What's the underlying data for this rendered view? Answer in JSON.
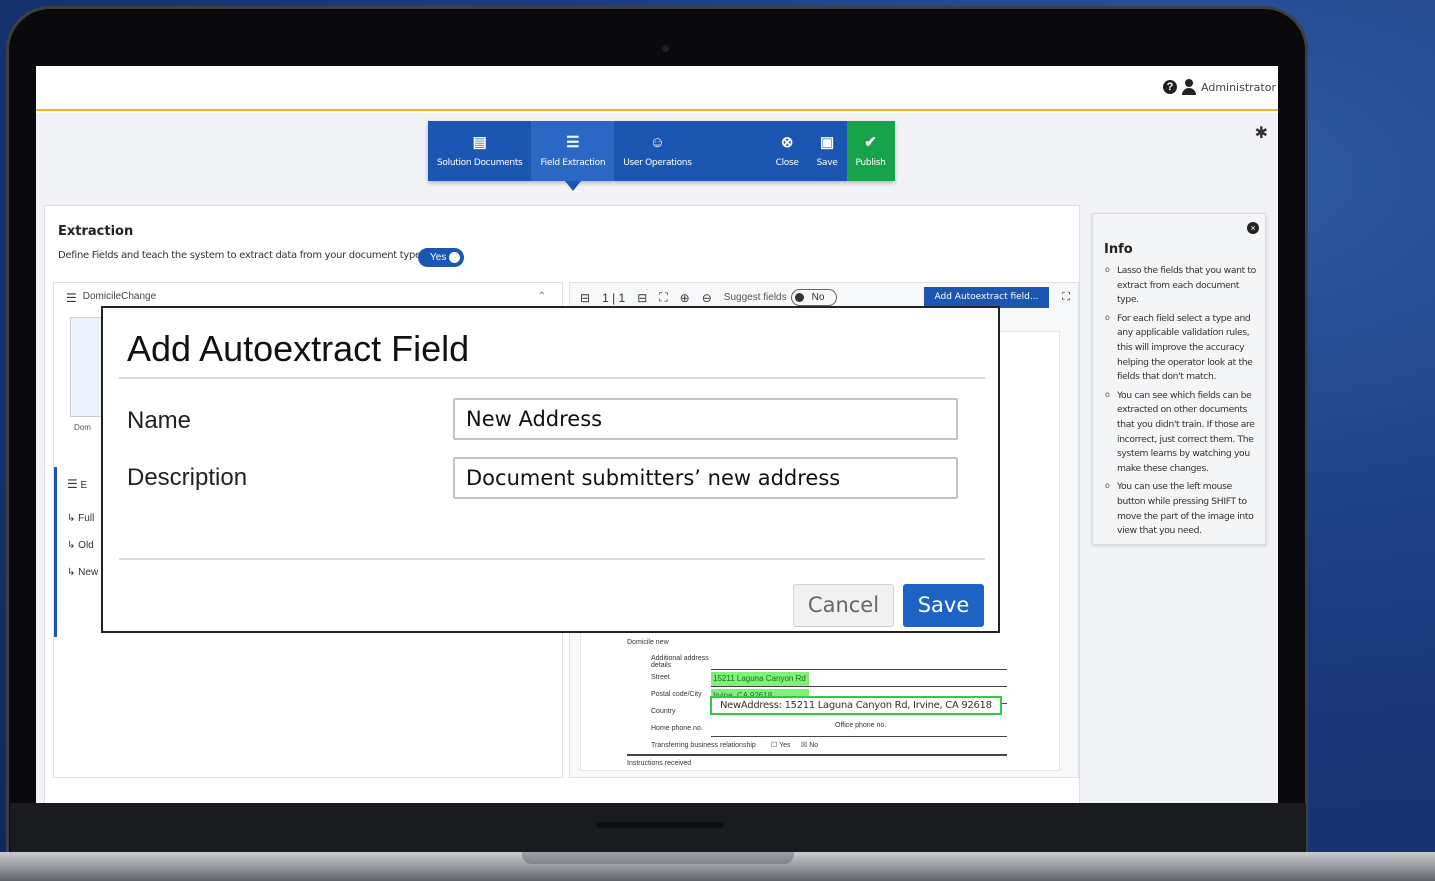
{
  "header": {
    "user_label": "Administrator"
  },
  "toolbar": {
    "solution_documents": "Solution Documents",
    "field_extraction": "Field Extraction",
    "user_operations": "User Operations",
    "close": "Close",
    "save": "Save",
    "publish": "Publish",
    "accent": "#1c56b3",
    "publish_color": "#16a34a"
  },
  "extraction": {
    "title": "Extraction",
    "subtitle": "Define Fields and teach the system to extract data from your document types",
    "toggle": "Yes",
    "document_name": "DomicileChange",
    "thumb_label": "Dom",
    "fields_card_label": "E",
    "fields": [
      "Full",
      "Old",
      "New"
    ]
  },
  "viewer": {
    "page_counter": "1 | 1",
    "suggest_label": "Suggest fields",
    "suggest_toggle": "No",
    "add_button": "Add Autoextract field..."
  },
  "document": {
    "section": "Domicile new",
    "rows": [
      "Additional address details",
      "Street",
      "Postal code/City",
      "Country",
      "Home phone no.",
      "Transferring business relationship"
    ],
    "street_value": "15211 Laguna Canyon Rd",
    "city_value": "Irvine, CA 92618",
    "office_phone_label": "Office phone no.",
    "yes_label": "Yes",
    "no_label": "No",
    "instructions": "Instructions received",
    "tooltip": "NewAddress: 15211 Laguna Canyon Rd, Irvine, CA 92618"
  },
  "info": {
    "title": "Info",
    "items": [
      "Lasso the fields that you want to extract from each document type.",
      "For each field select a type and any applicable validation rules, this will improve the accuracy helping the operator look at the fields that don't match.",
      "You can see which fields can be extracted on other documents that you didn't train. If those are incorrect, just correct them. The system learns by watching you make these changes.",
      "You can use the left mouse button while pressing SHIFT to move the part of the image into view that you need."
    ]
  },
  "modal": {
    "title": "Add Autoextract Field",
    "name_label": "Name",
    "name_value": "New Address",
    "description_label": "Description",
    "description_value": "Document submitters’ new address",
    "cancel": "Cancel",
    "save": "Save"
  }
}
